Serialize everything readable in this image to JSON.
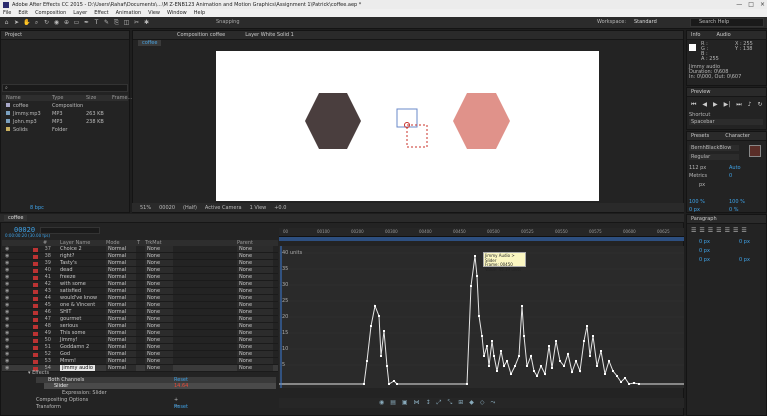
{
  "titlebar": {
    "title": "Adobe After Effects CC 2015 - D:\\Users\\Rahaf\\Documents\\...\\M Z-ENB123 Animation and Motion Graphics\\Assignment 1\\Patrick\\coffee.aep *",
    "controls": [
      "—",
      "□",
      "×"
    ]
  },
  "menu": [
    "File",
    "Edit",
    "Composition",
    "Layer",
    "Effect",
    "Animation",
    "View",
    "Window",
    "Help"
  ],
  "toolbar": {
    "snapping": "Snapping",
    "workspace_label": "Workspace:",
    "workspace_value": "Standard",
    "search_placeholder": "Search Help"
  },
  "project": {
    "tab": "Project",
    "columns": [
      "Name",
      "Type",
      "Size",
      "Frame..."
    ],
    "items": [
      {
        "name": "coffee",
        "type": "Composition",
        "size": "",
        "color": "#a8a8c8"
      },
      {
        "name": "Jimmy.mp3",
        "type": "MP3",
        "size": "263 KB",
        "color": "#7aa0c0"
      },
      {
        "name": "John.mp3",
        "type": "MP3",
        "size": "238 KB",
        "color": "#7aa0c0"
      },
      {
        "name": "Solids",
        "type": "Folder",
        "size": "",
        "color": "#c9b060"
      }
    ],
    "bpc": "8 bpc"
  },
  "composition": {
    "tab": "Composition coffee",
    "layer_tab": "Layer White Solid 1",
    "breadcrumb": "coffee",
    "viewer": {
      "zoom": "51%",
      "time": "00020",
      "resolution": "(Half)",
      "camera": "Active Camera",
      "views": "1 View",
      "exposure": "+0.0"
    },
    "colors": {
      "hexagon_dark": "#4a3e3e",
      "hexagon_pink": "#e0928a"
    }
  },
  "info": {
    "tab": "Info",
    "audio_tab": "Audio",
    "r": "R :",
    "g": "G :",
    "b": "B :",
    "a": "A : 255",
    "x": "X : 255",
    "y": "Y : 138",
    "details": [
      "Jimmy audio",
      "Duration: 0\\608",
      "In: 0\\000, Out: 0\\607"
    ]
  },
  "preview": {
    "tab": "Preview",
    "shortcut_label": "Shortcut",
    "shortcut_value": "Spacebar"
  },
  "character": {
    "tabs": [
      "Character",
      "Presets"
    ],
    "font": "BernhBlackBlow",
    "style": "Regular",
    "size": "112 px",
    "leading": "Auto",
    "tracking": "Metrics",
    "kern": "0",
    "units": "px",
    "scale_v": "100 %",
    "scale_h": "100 %",
    "baseline": "0 px",
    "tsume": "0 %"
  },
  "paragraph": {
    "tab": "Paragraph",
    "indent1": "0 px",
    "indent2": "0 px",
    "indent3": "0 px",
    "space1": "0 px",
    "space2": "0 px"
  },
  "timeline": {
    "tab": "coffee",
    "timecode": "00020",
    "frames": "0:00:00:20 (30.00 fps)",
    "columns": [
      "#",
      "Layer Name",
      "Mode",
      "T",
      "TrkMat",
      "Parent"
    ],
    "layers": [
      {
        "num": "37",
        "name": "Choice 2",
        "mode": "Normal",
        "trk": "None",
        "parent": "None"
      },
      {
        "num": "38",
        "name": "right?",
        "mode": "Normal",
        "trk": "None",
        "parent": "None"
      },
      {
        "num": "39",
        "name": "Tasty's",
        "mode": "Normal",
        "trk": "None",
        "parent": "None"
      },
      {
        "num": "40",
        "name": "dead",
        "mode": "Normal",
        "trk": "None",
        "parent": "None"
      },
      {
        "num": "41",
        "name": "freeze",
        "mode": "Normal",
        "trk": "None",
        "parent": "None"
      },
      {
        "num": "42",
        "name": "with some",
        "mode": "Normal",
        "trk": "None",
        "parent": "None"
      },
      {
        "num": "43",
        "name": "satisfied",
        "mode": "Normal",
        "trk": "None",
        "parent": "None"
      },
      {
        "num": "44",
        "name": "would've know",
        "mode": "Normal",
        "trk": "None",
        "parent": "None"
      },
      {
        "num": "45",
        "name": "one & Vincent",
        "mode": "Normal",
        "trk": "None",
        "parent": "None"
      },
      {
        "num": "46",
        "name": "SHIT",
        "mode": "Normal",
        "trk": "None",
        "parent": "None"
      },
      {
        "num": "47",
        "name": "gourmet",
        "mode": "Normal",
        "trk": "None",
        "parent": "None"
      },
      {
        "num": "48",
        "name": "serious",
        "mode": "Normal",
        "trk": "None",
        "parent": "None"
      },
      {
        "num": "49",
        "name": "This some",
        "mode": "Normal",
        "trk": "None",
        "parent": "None"
      },
      {
        "num": "50",
        "name": "Jimmy!",
        "mode": "Normal",
        "trk": "None",
        "parent": "None"
      },
      {
        "num": "51",
        "name": "Goddamn 2",
        "mode": "Normal",
        "trk": "None",
        "parent": "None"
      },
      {
        "num": "52",
        "name": "God",
        "mode": "Normal",
        "trk": "None",
        "parent": "None"
      },
      {
        "num": "53",
        "name": "Mmm!",
        "mode": "Normal",
        "trk": "None",
        "parent": "None"
      },
      {
        "num": "54",
        "name": "jimmy audio",
        "mode": "Normal",
        "trk": "None",
        "parent": "None"
      }
    ],
    "effects": {
      "effects_label": "Effects",
      "both_channels": "Both Channels",
      "slider": "Slider",
      "slider_value": "14.64",
      "expression": "Expression: Slider",
      "compositing": "Compositing Options",
      "transform": "Transform",
      "reset": "Reset",
      "reset2": "Reset",
      "reset3": "Reset"
    },
    "ruler": [
      "00",
      "00100",
      "00200",
      "00300",
      "00400",
      "00450",
      "00500",
      "00525",
      "00550",
      "00575",
      "00600",
      "00625"
    ],
    "graph_labels": [
      "40 units",
      "35",
      "30",
      "25",
      "20",
      "15",
      "10",
      "5"
    ],
    "tooltip": [
      "Jimmy Audio > Slider",
      "Frame: 00450",
      "Value: 45.19 units"
    ]
  }
}
